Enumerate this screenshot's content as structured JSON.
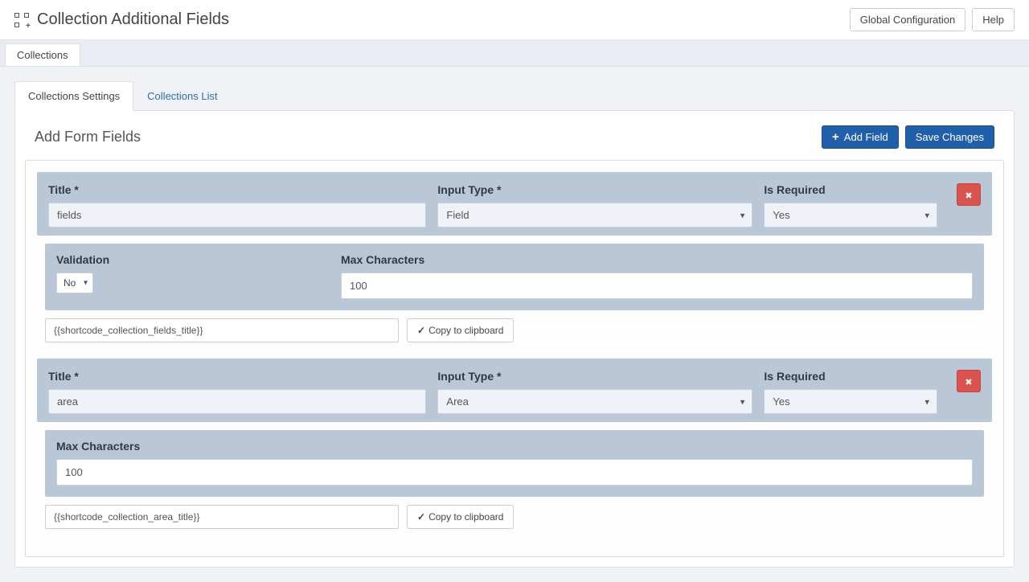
{
  "header": {
    "title": "Collection Additional Fields",
    "global_config": "Global Configuration",
    "help": "Help"
  },
  "tabs": {
    "collections": "Collections"
  },
  "subtabs": {
    "settings": "Collections Settings",
    "list": "Collections List"
  },
  "panel": {
    "title": "Add Form Fields",
    "add_field": "Add Field",
    "save_changes": "Save Changes"
  },
  "labels": {
    "title": "Title *",
    "input_type": "Input Type *",
    "is_required": "Is Required",
    "validation": "Validation",
    "max_chars": "Max Characters",
    "copy": "Copy to clipboard"
  },
  "fields": [
    {
      "title_value": "fields",
      "input_type": "Field",
      "is_required": "Yes",
      "has_validation": true,
      "validation": "No",
      "max_chars": "100",
      "shortcode": "{{shortcode_collection_fields_title}}"
    },
    {
      "title_value": "area",
      "input_type": "Area",
      "is_required": "Yes",
      "has_validation": false,
      "max_chars": "100",
      "shortcode": "{{shortcode_collection_area_title}}"
    }
  ]
}
